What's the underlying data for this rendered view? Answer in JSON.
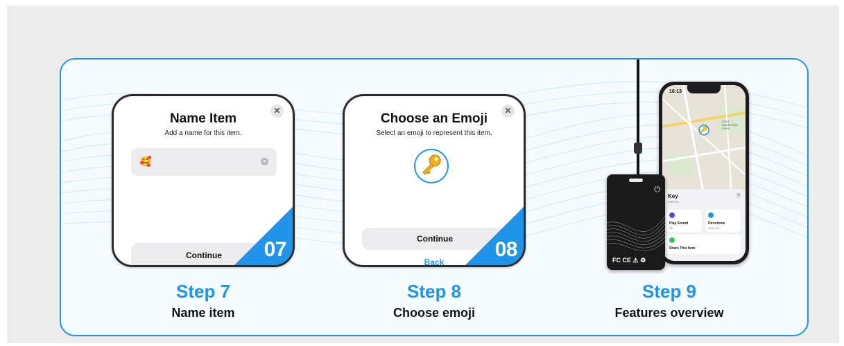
{
  "steps": [
    {
      "label": "Step 7",
      "description": "Name item",
      "badge": "07",
      "screen": {
        "title": "Name Item",
        "subtitle": "Add a name for this item.",
        "input_value": "🥰",
        "button_label": "Continue"
      }
    },
    {
      "label": "Step 8",
      "description": "Choose emoji",
      "badge": "08",
      "screen": {
        "title": "Choose an Emoji",
        "subtitle": "Select an emoji to represent this item.",
        "selected_emoji": "🔑",
        "button_label": "Continue",
        "back_label": "Back"
      }
    },
    {
      "label": "Step 9",
      "description": "Features overview",
      "phone": {
        "time": "16:13",
        "map_labels": [
          "SOLE INDUSTRIAL ZONE"
        ],
        "item_name": "Key",
        "item_sub": "With You",
        "actions": [
          {
            "title": "Play Sound",
            "sub": "Off"
          },
          {
            "title": "Directions",
            "sub": "With You"
          }
        ],
        "share_label": "Share This Item"
      },
      "tag_marks": "FC CE ⚠ ♻"
    }
  ],
  "colors": {
    "accent": "#1f94e8",
    "background": "#ececec",
    "card_border": "#1f94e8"
  }
}
